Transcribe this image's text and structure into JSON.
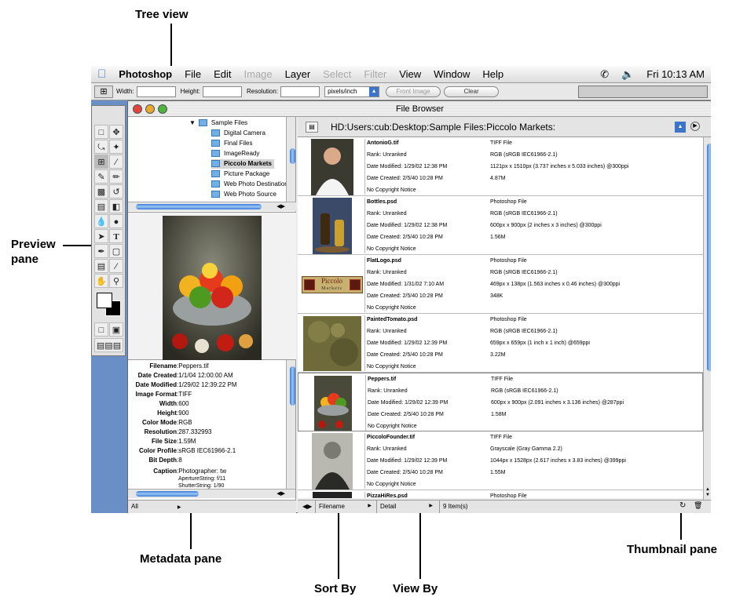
{
  "callouts": {
    "tree_view": "Tree view",
    "preview_pane": "Preview\npane",
    "preview_line1": "Preview",
    "preview_line2": "pane",
    "metadata_pane": "Metadata pane",
    "sort_by": "Sort By",
    "view_by": "View By",
    "thumbnail_pane": "Thumbnail pane"
  },
  "menubar": {
    "app": "Photoshop",
    "items": [
      "File",
      "Edit",
      "Image",
      "Layer",
      "Select",
      "Filter",
      "View",
      "Window",
      "Help"
    ],
    "disabled": [
      "Image",
      "Select",
      "Filter"
    ],
    "clock": "Fri 10:13 AM"
  },
  "optionsbar": {
    "width_label": "Width:",
    "height_label": "Height:",
    "resolution_label": "Resolution:",
    "units": "pixels/inch",
    "front_image": "Front Image",
    "clear": "Clear"
  },
  "window": {
    "title": "File Browser",
    "path": "HD:Users:cub:Desktop:Sample Files:Piccolo Markets:"
  },
  "tree": {
    "root": "Sample Files",
    "items": [
      "Digital Camera",
      "Final Files",
      "ImageReady",
      "Piccolo Markets",
      "Picture Package",
      "Web Photo Destination",
      "Web Photo Source"
    ],
    "selected": "Piccolo Markets"
  },
  "metadata": [
    {
      "k": "Filename",
      "v": "Peppers.tif"
    },
    {
      "k": "Date Created",
      "v": "1/1/04 12:00:00 AM"
    },
    {
      "k": "Date Modified",
      "v": "1/29/02 12:39:22 PM"
    },
    {
      "k": "Image Format",
      "v": "TIFF"
    },
    {
      "k": "Width",
      "v": "600"
    },
    {
      "k": "Height",
      "v": "900"
    },
    {
      "k": "Color Mode",
      "v": "RGB"
    },
    {
      "k": "Resolution",
      "v": "287.332993"
    },
    {
      "k": "File Size",
      "v": "1.59M"
    },
    {
      "k": "Color Profile",
      "v": "sRGB IEC61966-2.1"
    },
    {
      "k": "Bit Depth",
      "v": "8"
    },
    {
      "k": "Caption",
      "v": "Photographer: tw"
    }
  ],
  "caption_extra": [
    "ApertureString: f/11",
    "ShutterString: 1/90"
  ],
  "meta_filter": "All",
  "files": [
    {
      "name": "AntonioG.tif",
      "rank": "Rank: Unranked",
      "mod": "Date Modified: 1/29/02  12:38 PM",
      "created": "Date Created: 2/5/40  10:28 PM",
      "copy": "No Copyright Notice",
      "type": "TIFF File",
      "profile": "RGB (sRGB IEC61966-2.1)",
      "dims": "1121px x 1510px (3.737 inches x 5.033 inches) @300ppi",
      "size": "4.87M",
      "thumb": "portrait"
    },
    {
      "name": "Bottles.psd",
      "rank": "Rank: Unranked",
      "mod": "Date Modified: 1/29/02  12:38 PM",
      "created": "Date Created: 2/5/40  10:28 PM",
      "copy": "No Copyright Notice",
      "type": "Photoshop File",
      "profile": "RGB (sRGB IEC61966-2.1)",
      "dims": "600px x 900px (2 inches x 3 inches) @300ppi",
      "size": "1.56M",
      "thumb": "bottles"
    },
    {
      "name": "FlatLogo.psd",
      "rank": "Rank: Unranked",
      "mod": "Date Modified: 1/31/02  7:10 AM",
      "created": "Date Created: 2/5/40  10:28 PM",
      "copy": "No Copyright Notice",
      "type": "Photoshop File",
      "profile": "RGB (sRGB IEC61966-2.1)",
      "dims": "469px x 138px (1.563 inches x 0.46 inches) @300ppi",
      "size": "348K",
      "thumb": "logo"
    },
    {
      "name": "PaintedTomato.psd",
      "rank": "Rank: Unranked",
      "mod": "Date Modified: 1/29/02  12:39 PM",
      "created": "Date Created: 2/5/40  10:28 PM",
      "copy": "No Copyright Notice",
      "type": "Photoshop File",
      "profile": "RGB (sRGB IEC61966-2.1)",
      "dims": "659px x 659px (1 inch x 1 inch) @659ppi",
      "size": "3.22M",
      "thumb": "painted"
    },
    {
      "name": "Peppers.tif",
      "rank": "Rank: Unranked",
      "mod": "Date Modified: 1/29/02  12:39 PM",
      "created": "Date Created: 2/5/40  10:28 PM",
      "copy": "No Copyright Notice",
      "type": "TIFF File",
      "profile": "RGB (sRGB IEC61966-2.1)",
      "dims": "600px x 900px (2.091 inches x 3.136 inches) @287ppi",
      "size": "1.58M",
      "thumb": "peppers"
    },
    {
      "name": "PiccoloFounder.tif",
      "rank": "Rank: Unranked",
      "mod": "Date Modified: 1/29/02  12:39 PM",
      "created": "Date Created: 2/5/40  10:28 PM",
      "copy": "No Copyright Notice",
      "type": "TIFF File",
      "profile": "Grayscale (Gray Gamma 2.2)",
      "dims": "1044px x 1528px (2.617 inches x 3.83 inches) @399ppi",
      "size": "1.55M",
      "thumb": "founder"
    },
    {
      "name": "PizzaHiRes.psd",
      "rank": "",
      "mod": "",
      "created": "",
      "copy": "",
      "type": "Photoshop File",
      "profile": "",
      "dims": "",
      "size": "",
      "thumb": "pizza"
    }
  ],
  "logo_text": {
    "top": "Piccolo",
    "bottom": "Markets"
  },
  "bottombar": {
    "sort": "Filename",
    "view": "Detail",
    "count": "9 Item(s)"
  }
}
